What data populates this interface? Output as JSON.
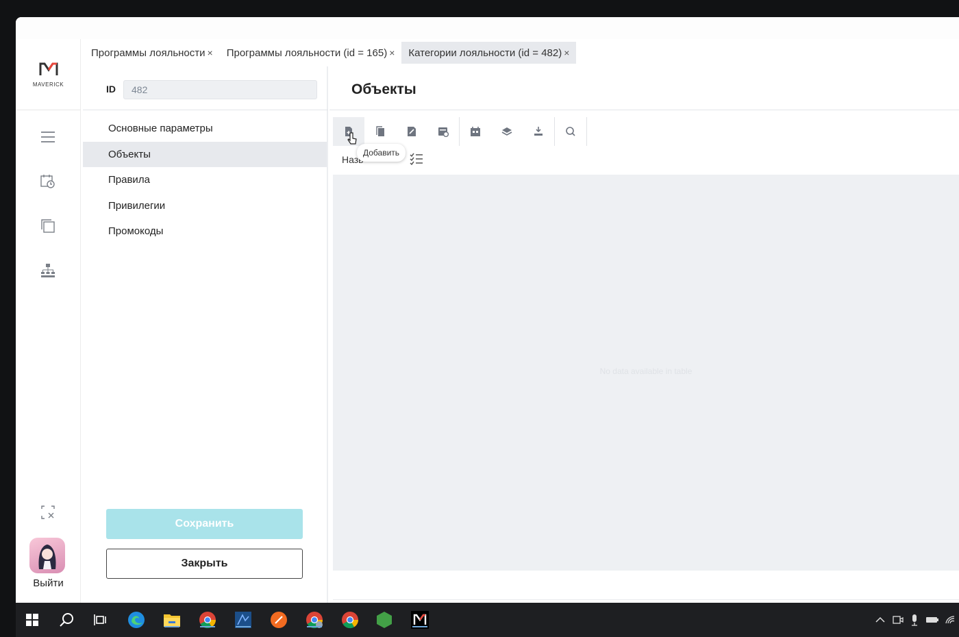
{
  "logo": {
    "brand": "MAVERICK"
  },
  "tabs": [
    {
      "label": "Программы лояльности",
      "close": "×"
    },
    {
      "label": "Программы лояльности (id = 165)",
      "close": "×"
    },
    {
      "label": "Категории лояльности (id = 482)",
      "close": "×",
      "active": true
    }
  ],
  "form": {
    "id_label": "ID",
    "id_value": "482"
  },
  "nav": {
    "items": [
      {
        "label": "Основные параметры"
      },
      {
        "label": "Объекты",
        "active": true
      },
      {
        "label": "Правила"
      },
      {
        "label": "Привилегии"
      },
      {
        "label": "Промокоды"
      }
    ]
  },
  "actions": {
    "save": "Сохранить",
    "close": "Закрыть"
  },
  "user": {
    "exit": "Выйти"
  },
  "content": {
    "title": "Объекты",
    "tooltip": "Добавить",
    "column_header": "Назв",
    "empty_text": "No data available in table"
  },
  "icons": {
    "toolbar": [
      "add-document-icon",
      "copy-icon",
      "edit-icon",
      "card-settings-icon",
      "calendar-icon",
      "layers-icon",
      "import-icon",
      "search-icon"
    ],
    "rail": [
      "menu-icon",
      "calendar-clock-icon",
      "copy-window-icon",
      "organization-icon",
      "fullscreen-exit-icon"
    ]
  },
  "colors": {
    "save_button": "#a9e3ea",
    "active_bg": "#e7e9ed",
    "grid_bg": "#eef0f3"
  }
}
